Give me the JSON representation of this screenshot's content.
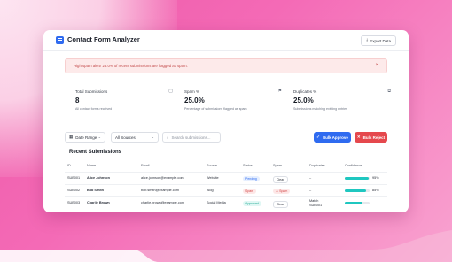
{
  "app": {
    "title": "Contact Form Analyzer",
    "export_label": "Export Data"
  },
  "alert": {
    "text": "High spam alert! 25.0% of recent submissions are flagged as spam.",
    "close": "×"
  },
  "stats": [
    {
      "label": "Total Submissions",
      "value": "8",
      "sub": "All contact forms received"
    },
    {
      "label": "Spam %",
      "value": "25.0%",
      "sub": "Percentage of submissions flagged as spam"
    },
    {
      "label": "Duplicates %",
      "value": "25.0%",
      "sub": "Submissions matching existing entries"
    }
  ],
  "filters": {
    "date_range": "Date Range",
    "sources": "All Sources",
    "search_placeholder": "Search submissions...",
    "bulk_approve": "Bulk Approve",
    "bulk_reject": "Bulk Reject"
  },
  "table": {
    "title": "Recent Submissions",
    "headers": [
      "ID",
      "Name",
      "Email",
      "Source",
      "Status",
      "Spam",
      "Duplicates",
      "Confidence"
    ],
    "rows": [
      {
        "id": "SUB001",
        "name": "Alice Johnson",
        "email": "alice.johnson@example.com",
        "source": "Website",
        "status": "Pending",
        "spam": "Clean",
        "duplicates": "–",
        "confidence": "95%",
        "confidence_frac": 0.95,
        "status_kind": "pending",
        "spam_kind": "clean"
      },
      {
        "id": "SUB002",
        "name": "Bob Smith",
        "email": "bob.smith@example.com",
        "source": "Blog",
        "status": "Spam",
        "spam": "Spam",
        "duplicates": "–",
        "confidence": "85%",
        "confidence_frac": 0.85,
        "status_kind": "spam",
        "spam_kind": "spam"
      },
      {
        "id": "SUB003",
        "name": "Charlie Brown",
        "email": "charlie.brown@example.com",
        "source": "Social Media",
        "status": "Approved",
        "spam": "Clean",
        "duplicates": "Match SUB001",
        "confidence": "",
        "confidence_frac": 0.7,
        "status_kind": "approved",
        "spam_kind": "clean"
      }
    ]
  },
  "colors": {
    "accent": "#2f6bf0",
    "danger": "#e5484d",
    "teal": "#1fc7c0"
  }
}
